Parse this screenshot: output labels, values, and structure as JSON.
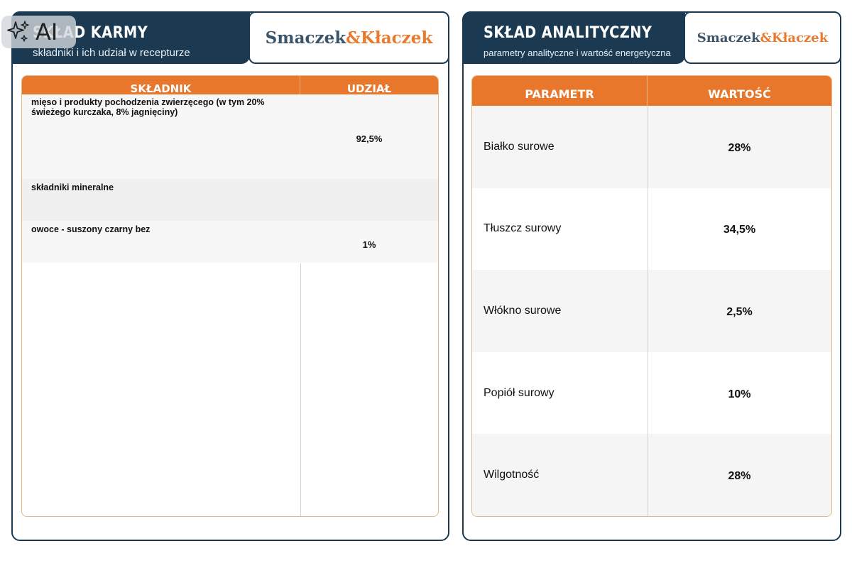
{
  "badge": {
    "label": "AI"
  },
  "left": {
    "title": "SKŁAD KARMY",
    "subtitle": "składniki i ich udział w recepturze",
    "logo": {
      "part1": "Smaczek",
      "part2": "&Kłaczek"
    },
    "columns": [
      "SKŁADNIK",
      "UDZIAŁ"
    ],
    "rows": [
      {
        "name": "mięso i produkty pochodzenia zwierzęcego (w tym 20% świeżego kurczaka, 8% jagnięciny)",
        "share": "92,5%"
      },
      {
        "name": "składniki mineralne",
        "share": ""
      },
      {
        "name": "owoce - suszony czarny bez",
        "share": "1%"
      }
    ]
  },
  "right": {
    "title": "SKŁAD ANALITYCZNY",
    "subtitle": "parametry analityczne i wartość energetyczna",
    "logo": {
      "part1": "Smaczek",
      "part2": "&Kłaczek"
    },
    "columns": [
      "PARAMETR",
      "WARTOŚĆ"
    ],
    "rows": [
      {
        "param": "Białko surowe",
        "value": "28%"
      },
      {
        "param": "Tłuszcz surowy",
        "value": "34,5%"
      },
      {
        "param": "Włókno surowe",
        "value": "2,5%"
      },
      {
        "param": "Popiół surowy",
        "value": "10%"
      },
      {
        "param": "Wilgotność",
        "value": "28%"
      }
    ]
  },
  "colors": {
    "navy": "#1b3a52",
    "orange": "#e8772b",
    "logo_dark": "#3c5469",
    "logo_orange": "#e87a2e"
  }
}
